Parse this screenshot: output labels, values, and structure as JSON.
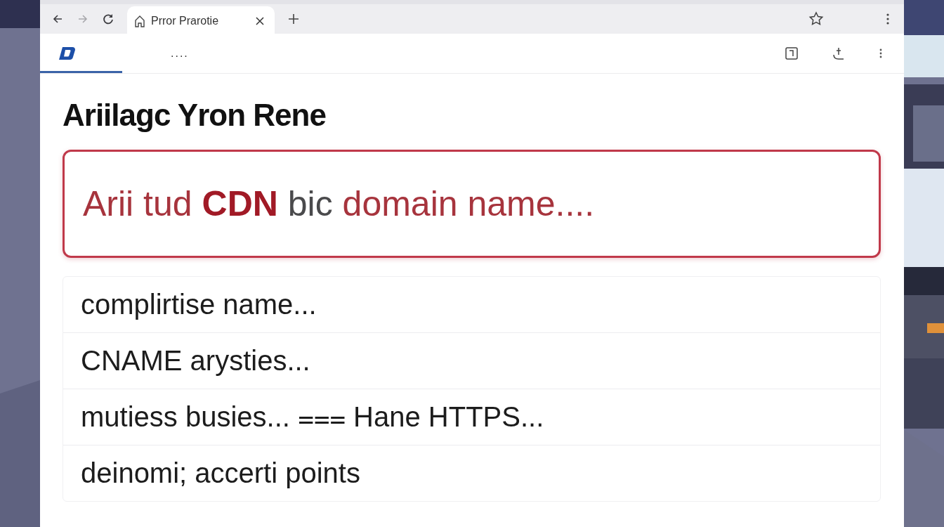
{
  "browser": {
    "tab": {
      "title": "Prror Prarotie",
      "selected": true
    },
    "nav": [
      {
        "kind": "back",
        "disabled": false
      },
      {
        "kind": "forward",
        "disabled": true
      },
      {
        "kind": "reload",
        "disabled": false
      }
    ]
  },
  "toolbar": {
    "overflow": "....",
    "active_tab_underline": true
  },
  "page": {
    "heading": "Ariilagc Yron Rene",
    "alert": [
      {
        "text": "Arii tud",
        "kind": "red"
      },
      {
        "text": "CDN",
        "kind": "strong"
      },
      {
        "text": "bic",
        "kind": "grey"
      },
      {
        "text": "domain name....",
        "kind": "red"
      }
    ],
    "rows": [
      {
        "text": "complirtise name..."
      },
      {
        "text": "CNAME arysties..."
      },
      {
        "text": "mutiess busies... ⩶ Hane HTTPS..."
      },
      {
        "text": "deinomi; accerti points"
      }
    ]
  }
}
